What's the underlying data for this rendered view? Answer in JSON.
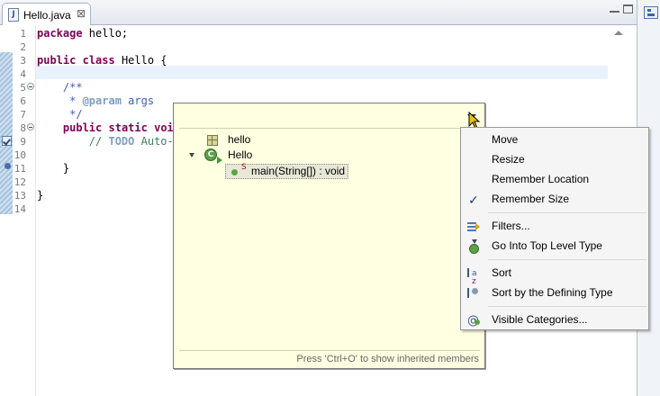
{
  "tab": {
    "title": "Hello.java",
    "icon": "java-file-icon",
    "close_glyph": "⊠"
  },
  "editor": {
    "line_numbers": [
      "1",
      "2",
      "3",
      "4",
      "5",
      "6",
      "7",
      "8",
      "9",
      "10",
      "11",
      "12",
      "13",
      "14"
    ],
    "lines": {
      "l1_kw": "package",
      "l1_rest": " hello;",
      "l3_kw1": "public",
      "l3_kw2": "class",
      "l3_rest": " Hello {",
      "l5": "    /**",
      "l6_pre": "     * ",
      "l6_tag": "@param",
      "l6_rest": " args",
      "l7": "     */",
      "l8_indent": "    ",
      "l8_kw1": "public",
      "l8_kw2": "static",
      "l8_kw3": "voi",
      "l9_indent": "        ",
      "l9_pre": "// ",
      "l9_todo": "TODO",
      "l9_rest": " Auto-g",
      "l11": "    }",
      "l13": "}"
    }
  },
  "quick_outline": {
    "package_label": "hello",
    "class_label": "Hello",
    "method_label": "main(String[]) : void",
    "static_badge": "S",
    "status_text": "Press 'Ctrl+O' to show inherited members"
  },
  "menu": {
    "move": "Move",
    "resize": "Resize",
    "remember_location": "Remember Location",
    "remember_size": "Remember Size",
    "filters": "Filters...",
    "go_into_top": "Go Into Top Level Type",
    "sort": "Sort",
    "sort_defining": "Sort by the Defining Type",
    "visible_categories": "Visible Categories...",
    "check_glyph": "✓"
  },
  "colors": {
    "keyword": "#7f0055",
    "javadoc": "#3f5fbf",
    "comment": "#3f7f5f",
    "popup_bg": "#ffffe1",
    "current_line": "#e8f2fe"
  }
}
